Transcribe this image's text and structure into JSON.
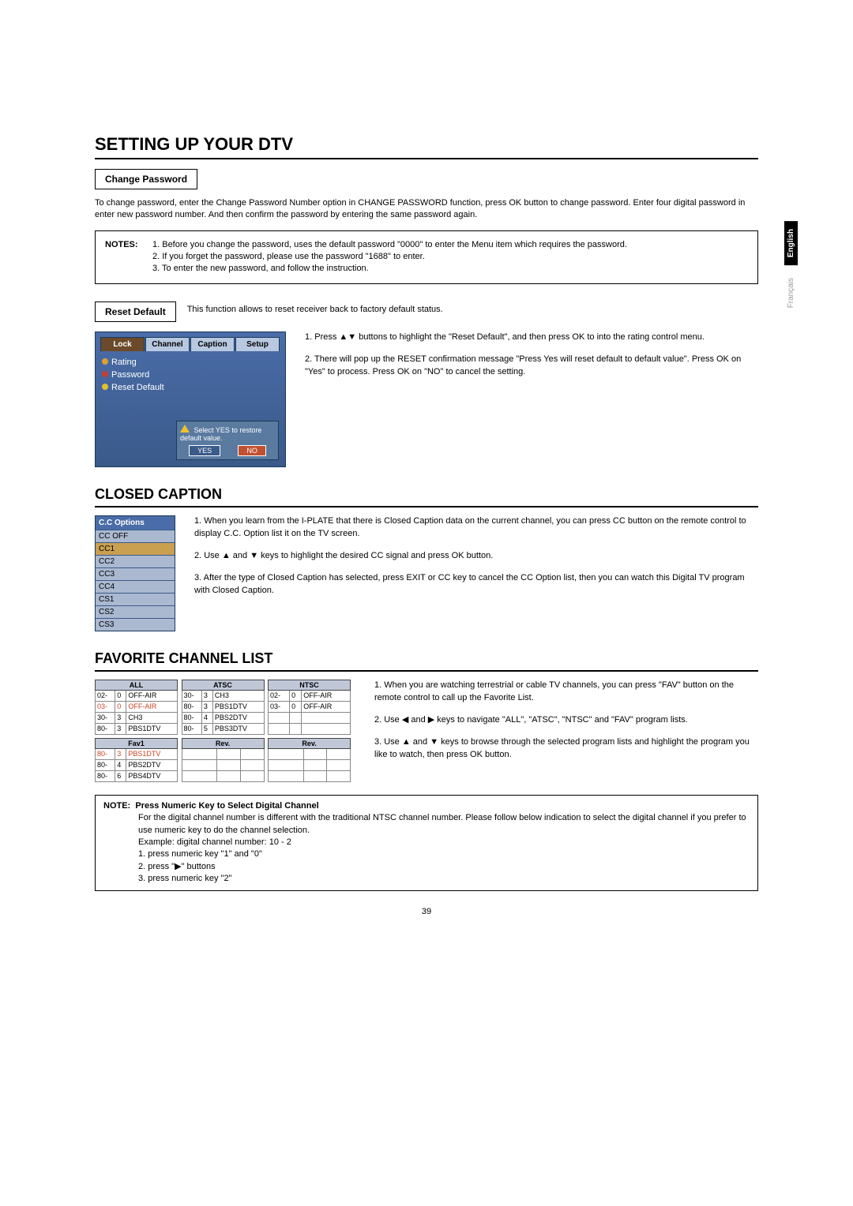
{
  "title_main": "SETTING UP YOUR DTV",
  "change_password": {
    "label": "Change Password",
    "para": "To change password, enter the Change Password Number option in CHANGE PASSWORD function, press OK button to change password. Enter four digital password in enter new password number. And then confirm the password by entering the same password again."
  },
  "notes_label": "NOTES:",
  "notes": [
    "1. Before you change the password, uses the default password \"0000\" to enter the Menu item which requires the password.",
    "2. If you forget the password, please use the password \"1688\" to enter.",
    "3. To enter the new password, and follow the instruction."
  ],
  "reset": {
    "label": "Reset Default",
    "desc": "This function allows to reset receiver back to factory default status.",
    "step1": "Press ▲▼ buttons to highlight the \"Reset Default\", and then press OK to into the rating control menu.",
    "step2": "There will pop up the RESET confirmation message \"Press Yes will reset default to default value\". Press OK on \"Yes\" to process. Press OK on \"NO\" to cancel the setting.",
    "tabs": [
      "Lock",
      "Channel",
      "Caption",
      "Setup"
    ],
    "menu": {
      "rating": "Rating",
      "password": "Password",
      "reset": "Reset Default"
    },
    "dialog": {
      "msg": "Select YES to restore default value.",
      "yes": "YES",
      "no": "NO"
    }
  },
  "cc": {
    "title": "CLOSED CAPTION",
    "step1": "1. When you learn from the I-PLATE that there is Closed Caption data on the current channel, you can press CC button on the remote control to display C.C. Option list it on the TV screen.",
    "step2": "2. Use ▲ and ▼ keys to highlight the desired CC signal and press OK button.",
    "step3": "3. After the type of Closed Caption has selected, press EXIT or CC key to cancel the CC Option list, then you can watch this Digital TV program with Closed Caption.",
    "img_hdr": "C.C Options",
    "opts": [
      "CC OFF",
      "CC1",
      "CC2",
      "CC3",
      "CC4",
      "CS1",
      "CS2",
      "CS3"
    ]
  },
  "fav": {
    "title": "FAVORITE CHANNEL LIST",
    "step1": "1. When you are watching terrestrial or cable TV channels, you can press \"FAV\" button on the remote control to call up the Favorite List.",
    "step2": "2. Use ◀ and ▶ keys to navigate \"ALL\", \"ATSC\", \"NTSC\" and \"FAV\" program lists.",
    "step3": "3. Use ▲ and ▼ keys to browse through the selected program lists and highlight the program you like to watch, then press OK button.",
    "tables": {
      "all": {
        "hdr": "ALL",
        "rows": [
          [
            "02-",
            "0",
            "OFF-AIR"
          ],
          [
            "03-",
            "0",
            "OFF-AIR"
          ],
          [
            "30-",
            "3",
            "CH3"
          ],
          [
            "80-",
            "3",
            "PBS1DTV"
          ]
        ]
      },
      "atsc": {
        "hdr": "ATSC",
        "rows": [
          [
            "30-",
            "3",
            "CH3"
          ],
          [
            "80-",
            "3",
            "PBS1DTV"
          ],
          [
            "80-",
            "4",
            "PBS2DTV"
          ],
          [
            "80-",
            "5",
            "PBS3DTV"
          ]
        ]
      },
      "ntsc": {
        "hdr": "NTSC",
        "rows": [
          [
            "02-",
            "0",
            "OFF-AIR"
          ],
          [
            "03-",
            "0",
            "OFF-AIR"
          ],
          [
            "",
            "",
            " "
          ],
          [
            "",
            "",
            " "
          ]
        ]
      },
      "fav1": {
        "hdr": "Fav1",
        "rows": [
          [
            "80-",
            "3",
            "PBS1DTV"
          ],
          [
            "80-",
            "4",
            "PBS2DTV"
          ],
          [
            "80-",
            "6",
            "PBS4DTV"
          ]
        ]
      },
      "rev1": {
        "hdr": "Rev.",
        "rows": [
          [
            "",
            "",
            " "
          ],
          [
            "",
            "",
            " "
          ],
          [
            "",
            "",
            " "
          ]
        ]
      },
      "rev2": {
        "hdr": "Rev.",
        "rows": [
          [
            "",
            "",
            " "
          ],
          [
            "",
            "",
            " "
          ],
          [
            "",
            "",
            " "
          ]
        ]
      }
    }
  },
  "note2": {
    "lead": "NOTE:",
    "heading": "Press Numeric Key to Select Digital Channel",
    "body": "For the digital channel number is different with the traditional NTSC channel number. Please follow below indication to select the digital channel if you prefer to use numeric key to do the channel selection.",
    "ex": "Example: digital channel number: 10 - 2",
    "l1": "1. press numeric key \"1\" and \"0\"",
    "l2": "2. press \"▶\" buttons",
    "l3": "3. press numeric key \"2\""
  },
  "sidetabs": {
    "en": "English",
    "fr": "Français"
  },
  "pagenum": "39"
}
